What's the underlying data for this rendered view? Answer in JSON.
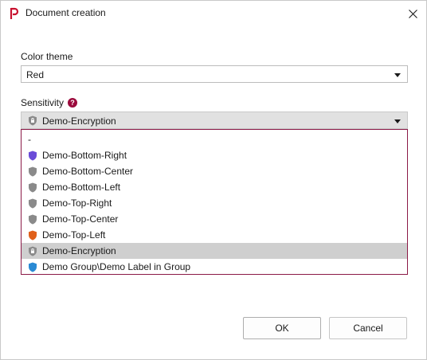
{
  "window": {
    "title": "Document creation",
    "accent_color": "#c8102e"
  },
  "color_theme": {
    "label": "Color theme",
    "value": "Red"
  },
  "sensitivity": {
    "label": "Sensitivity",
    "selected": "Demo-Encryption",
    "selected_icon": "lock-shield-icon",
    "options": [
      {
        "label": "-",
        "icon": "",
        "color": ""
      },
      {
        "label": "Demo-Bottom-Right",
        "icon": "shield-icon",
        "color": "#6a4bd8"
      },
      {
        "label": "Demo-Bottom-Center",
        "icon": "shield-icon",
        "color": "#8a8a8a"
      },
      {
        "label": "Demo-Bottom-Left",
        "icon": "shield-icon",
        "color": "#8a8a8a"
      },
      {
        "label": "Demo-Top-Right",
        "icon": "shield-icon",
        "color": "#8a8a8a"
      },
      {
        "label": "Demo-Top-Center",
        "icon": "shield-icon",
        "color": "#8a8a8a"
      },
      {
        "label": "Demo-Top-Left",
        "icon": "shield-icon",
        "color": "#e0601a"
      },
      {
        "label": "Demo-Encryption",
        "icon": "lock-shield-icon",
        "color": "#8a8a8a",
        "selected": true
      },
      {
        "label": "Demo Group\\Demo Label in Group",
        "icon": "shield-icon",
        "color": "#2a8ad4"
      }
    ]
  },
  "buttons": {
    "ok": "OK",
    "cancel": "Cancel"
  }
}
